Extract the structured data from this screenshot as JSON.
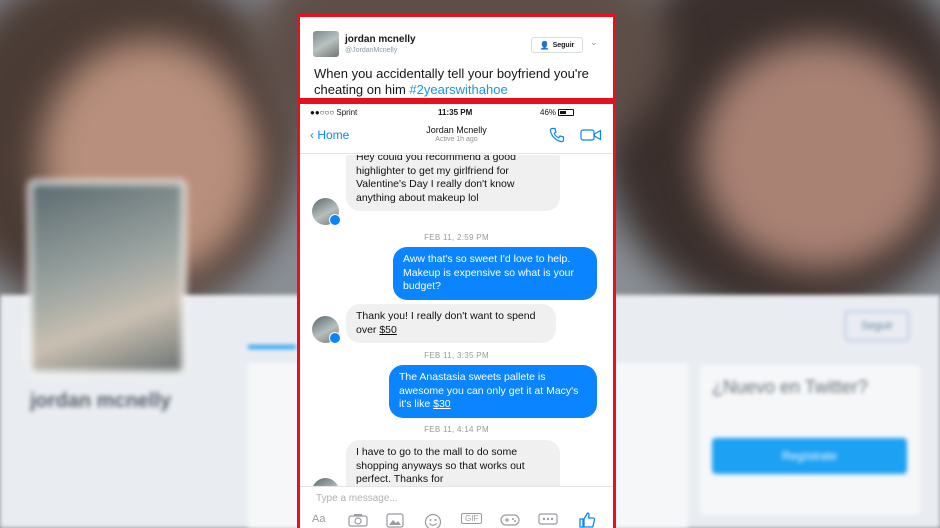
{
  "background_profile": {
    "name": "jordan mcnelly",
    "follow_label": "Seguir",
    "sidebar_title": "¿Nuevo en Twitter?",
    "sidebar_button": "Regístrate"
  },
  "tweet": {
    "name": "jordan mcnelly",
    "handle": "@JordanMcnelly",
    "follow_label": "Seguir",
    "text_before": "When you accidentally tell your boyfriend you're cheating on him ",
    "hashtag": "#2yearswithahoe"
  },
  "phone": {
    "status": {
      "carrier": "●●○○○ Sprint",
      "time": "11:35 PM",
      "battery": "46%"
    },
    "nav": {
      "back": "Home",
      "title": "Jordan Mcnelly",
      "subtitle": "Active 1h ago"
    },
    "messages": {
      "m1": "Hey could you recommend a good highlighter to get my girlfriend for Valentine's Day I really don't know anything about makeup lol",
      "t1": "FEB 11, 2:59 PM",
      "m2": "Aww that's so sweet I'd love to help. Makeup is expensive so what is your budget?",
      "m3_text": "Thank you! I really don't want to spend over ",
      "m3_money": "$50",
      "t2": "FEB 11, 3:35 PM",
      "m4_text": "The Anastasia sweets pallete is awesome you can only get it at Macy's it's like ",
      "m4_money": "$30",
      "t3": "FEB 11, 4:14 PM",
      "m5": "I have to go to the mall to do some shopping anyways so that works out perfect. Thanks for"
    },
    "composer": {
      "placeholder": "Type a message...",
      "tools": [
        "Aa",
        "camera-icon",
        "gallery-icon",
        "emoji-icon",
        "GIF",
        "game-icon",
        "more-icon",
        "like-icon"
      ]
    }
  },
  "colors": {
    "accent": "#0a84ff",
    "highlight_border": "#e8101d",
    "twitter_blue": "#1da1f2"
  }
}
